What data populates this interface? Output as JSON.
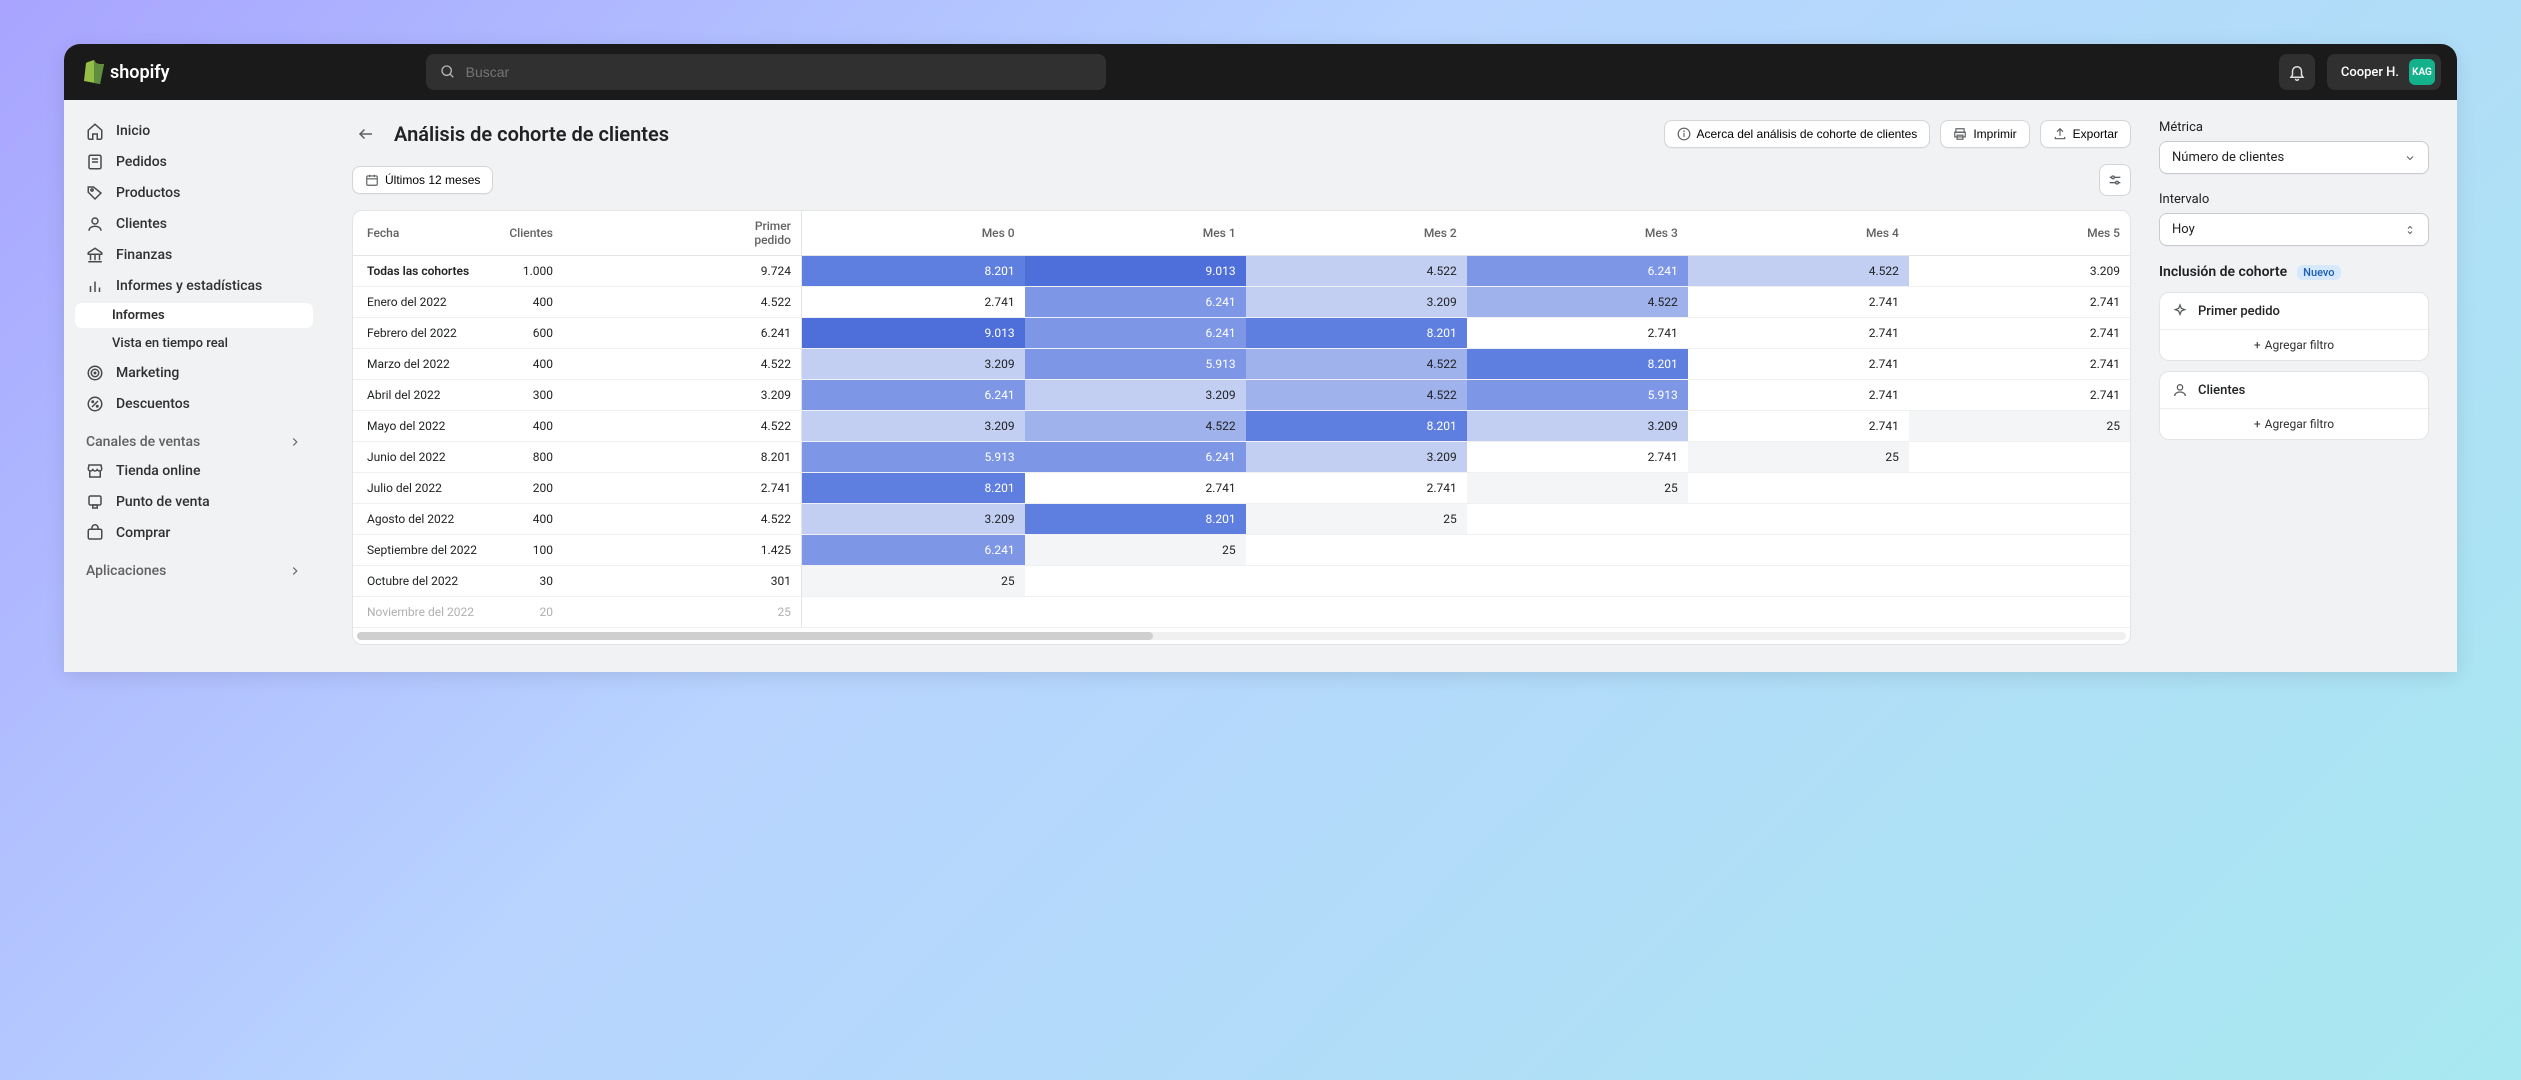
{
  "topbar": {
    "brand": "shopify",
    "search_placeholder": "Buscar",
    "user_name": "Cooper H.",
    "user_initials": "KAG"
  },
  "sidebar": {
    "items": [
      {
        "label": "Inicio",
        "icon": "home"
      },
      {
        "label": "Pedidos",
        "icon": "orders"
      },
      {
        "label": "Productos",
        "icon": "tag"
      },
      {
        "label": "Clientes",
        "icon": "user"
      },
      {
        "label": "Finanzas",
        "icon": "bank"
      },
      {
        "label": "Informes y estadísticas",
        "icon": "analytics"
      },
      {
        "label": "Marketing",
        "icon": "target"
      },
      {
        "label": "Descuentos",
        "icon": "discount"
      }
    ],
    "sub": [
      {
        "label": "Informes",
        "active": true
      },
      {
        "label": "Vista en tiempo real",
        "active": false
      }
    ],
    "sales_header": "Canales de ventas",
    "channels": [
      {
        "label": "Tienda online",
        "icon": "store"
      },
      {
        "label": "Punto de venta",
        "icon": "pos"
      },
      {
        "label": "Comprar",
        "icon": "shop"
      }
    ],
    "apps_header": "Aplicaciones"
  },
  "page": {
    "title": "Análisis de cohorte de clientes",
    "about": "Acerca del análisis de cohorte de clientes",
    "print": "Imprimir",
    "export": "Exportar",
    "date_range": "Últimos 12 meses"
  },
  "right": {
    "metric_label": "Métrica",
    "metric_value": "Número de clientes",
    "interval_label": "Intervalo",
    "interval_value": "Hoy",
    "inclusion_label": "Inclusión de cohorte",
    "new_badge": "Nuevo",
    "card1": "Primer pedido",
    "card2": "Clientes",
    "add_filter": "Agregar filtro"
  },
  "table": {
    "headers": [
      "Fecha",
      "Clientes",
      "Primer pedido",
      "Mes 0",
      "Mes 1",
      "Mes 2",
      "Mes 3",
      "Mes 4",
      "Mes 5"
    ],
    "rows": [
      {
        "label": "Todas las cohortes",
        "clientes": "1.000",
        "primer": "9.724",
        "m": [
          "8.201",
          "9.013",
          "4.522",
          "6.241",
          "4.522",
          "3.209"
        ],
        "c": [
          4,
          5,
          1,
          3,
          1,
          0
        ]
      },
      {
        "label": "Enero del 2022",
        "clientes": "400",
        "primer": "4.522",
        "m": [
          "2.741",
          "6.241",
          "3.209",
          "4.522",
          "2.741",
          "2.741"
        ],
        "c": [
          0,
          3,
          1,
          2,
          0,
          0
        ]
      },
      {
        "label": "Febrero del 2022",
        "clientes": "600",
        "primer": "6.241",
        "m": [
          "9.013",
          "6.241",
          "8.201",
          "2.741",
          "2.741",
          "2.741"
        ],
        "c": [
          5,
          3,
          4,
          0,
          0,
          0
        ]
      },
      {
        "label": "Marzo del 2022",
        "clientes": "400",
        "primer": "4.522",
        "m": [
          "3.209",
          "5.913",
          "4.522",
          "8.201",
          "2.741",
          "2.741"
        ],
        "c": [
          1,
          3,
          2,
          4,
          0,
          0
        ]
      },
      {
        "label": "Abril del 2022",
        "clientes": "300",
        "primer": "3.209",
        "m": [
          "6.241",
          "3.209",
          "4.522",
          "5.913",
          "2.741",
          "2.741"
        ],
        "c": [
          3,
          1,
          2,
          3,
          0,
          0
        ]
      },
      {
        "label": "Mayo del 2022",
        "clientes": "400",
        "primer": "4.522",
        "m": [
          "3.209",
          "4.522",
          "8.201",
          "3.209",
          "2.741",
          "25"
        ],
        "c": [
          1,
          2,
          4,
          1,
          0,
          -1
        ]
      },
      {
        "label": "Junio del 2022",
        "clientes": "800",
        "primer": "8.201",
        "m": [
          "5.913",
          "6.241",
          "3.209",
          "2.741",
          "25",
          ""
        ],
        "c": [
          3,
          3,
          1,
          0,
          -1,
          -2
        ]
      },
      {
        "label": "Julio del 2022",
        "clientes": "200",
        "primer": "2.741",
        "m": [
          "8.201",
          "2.741",
          "2.741",
          "25",
          "",
          ""
        ],
        "c": [
          4,
          0,
          0,
          -1,
          -2,
          -2
        ]
      },
      {
        "label": "Agosto del 2022",
        "clientes": "400",
        "primer": "4.522",
        "m": [
          "3.209",
          "8.201",
          "25",
          "",
          "",
          ""
        ],
        "c": [
          1,
          4,
          -1,
          -2,
          -2,
          -2
        ]
      },
      {
        "label": "Septiembre del 2022",
        "clientes": "100",
        "primer": "1.425",
        "m": [
          "6.241",
          "25",
          "",
          "",
          "",
          ""
        ],
        "c": [
          3,
          -1,
          -2,
          -2,
          -2,
          -2
        ]
      },
      {
        "label": "Octubre del 2022",
        "clientes": "30",
        "primer": "301",
        "m": [
          "25",
          "",
          "",
          "",
          "",
          ""
        ],
        "c": [
          -1,
          -2,
          -2,
          -2,
          -2,
          -2
        ]
      },
      {
        "label": "Noviembre del 2022",
        "clientes": "20",
        "primer": "25",
        "m": [
          "",
          "",
          "",
          "",
          "",
          ""
        ],
        "c": [
          -2,
          -2,
          -2,
          -2,
          -2,
          -2
        ],
        "dim": true
      }
    ]
  },
  "heat_colors": {
    "5": "#4e6fda",
    "4": "#5f7fe0",
    "3": "#7d96e5",
    "2": "#9fb2eb",
    "1": "#c3cff2",
    "0": "#ffffff",
    "-1": "#f4f5f6",
    "-2": "#ffffff"
  }
}
